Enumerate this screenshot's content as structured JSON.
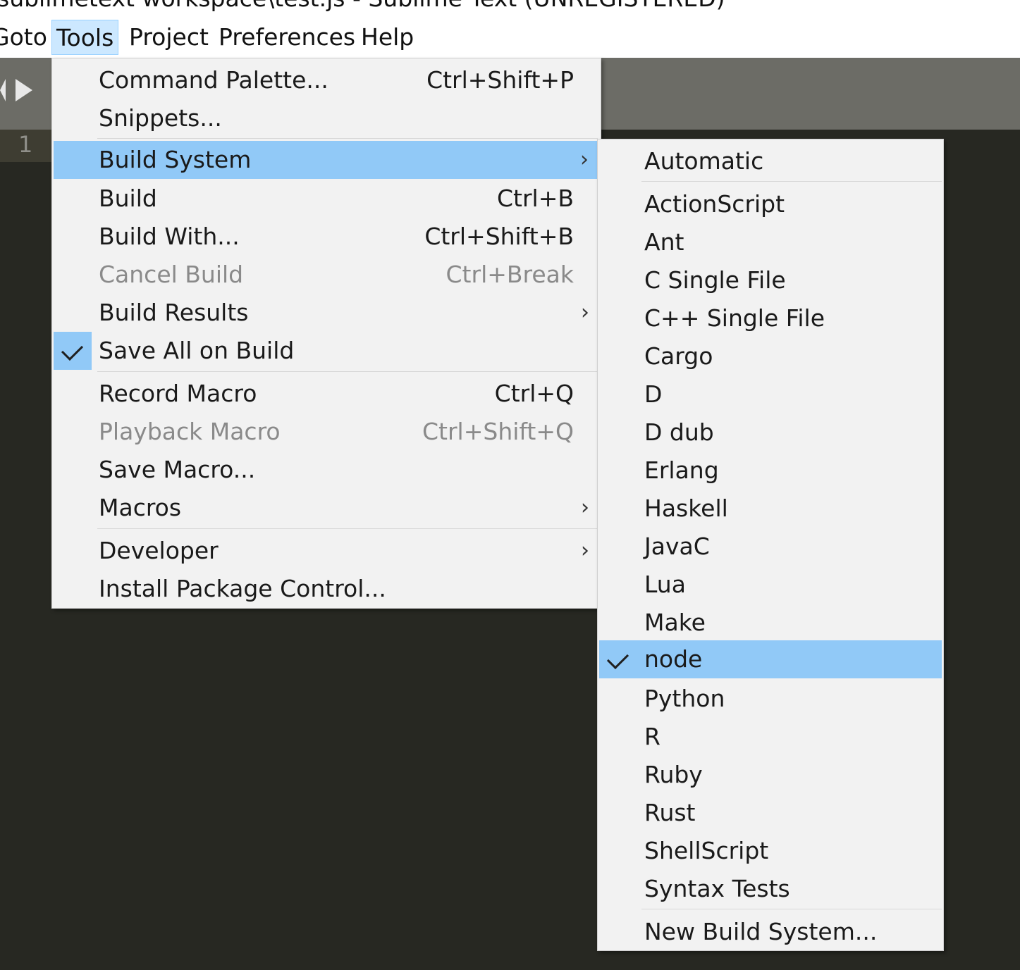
{
  "window": {
    "title": "sublimetext workspace\\test.js - Sublime Text (UNREGISTERED)",
    "line_number": "1"
  },
  "menubar": {
    "items": [
      {
        "label": "Goto"
      },
      {
        "label": "Tools"
      },
      {
        "label": "Project"
      },
      {
        "label": "Preferences"
      },
      {
        "label": "Help"
      }
    ],
    "active": "Tools"
  },
  "tools_menu": {
    "items": [
      {
        "label": "Command Palette...",
        "shortcut": "Ctrl+Shift+P"
      },
      {
        "label": "Snippets...",
        "shortcut": ""
      },
      {
        "label": "Build System",
        "shortcut": "",
        "submenu": true,
        "highlighted": true
      },
      {
        "label": "Build",
        "shortcut": "Ctrl+B"
      },
      {
        "label": "Build With...",
        "shortcut": "Ctrl+Shift+B"
      },
      {
        "label": "Cancel Build",
        "shortcut": "Ctrl+Break",
        "disabled": true
      },
      {
        "label": "Build Results",
        "shortcut": "",
        "submenu": true
      },
      {
        "label": "Save All on Build",
        "shortcut": "",
        "checked": true
      },
      {
        "label": "Record Macro",
        "shortcut": "Ctrl+Q"
      },
      {
        "label": "Playback Macro",
        "shortcut": "Ctrl+Shift+Q",
        "disabled": true
      },
      {
        "label": "Save Macro...",
        "shortcut": ""
      },
      {
        "label": "Macros",
        "shortcut": "",
        "submenu": true
      },
      {
        "label": "Developer",
        "shortcut": "",
        "submenu": true
      },
      {
        "label": "Install Package Control...",
        "shortcut": ""
      }
    ]
  },
  "build_system_menu": {
    "items": [
      {
        "label": "Automatic"
      },
      {
        "label": "ActionScript"
      },
      {
        "label": "Ant"
      },
      {
        "label": "C Single File"
      },
      {
        "label": "C++ Single File"
      },
      {
        "label": "Cargo"
      },
      {
        "label": "D"
      },
      {
        "label": "D dub"
      },
      {
        "label": "Erlang"
      },
      {
        "label": "Haskell"
      },
      {
        "label": "JavaC"
      },
      {
        "label": "Lua"
      },
      {
        "label": "Make"
      },
      {
        "label": "node",
        "checked": true,
        "highlighted": true
      },
      {
        "label": "Python"
      },
      {
        "label": "R"
      },
      {
        "label": "Ruby"
      },
      {
        "label": "Rust"
      },
      {
        "label": "ShellScript"
      },
      {
        "label": "Syntax Tests"
      },
      {
        "label": "New Build System..."
      }
    ]
  },
  "colors": {
    "highlight": "#91c9f7",
    "menubar_active": "#cce8ff",
    "editor_bg": "#272822",
    "tabbar_bg": "#6c6c66"
  }
}
